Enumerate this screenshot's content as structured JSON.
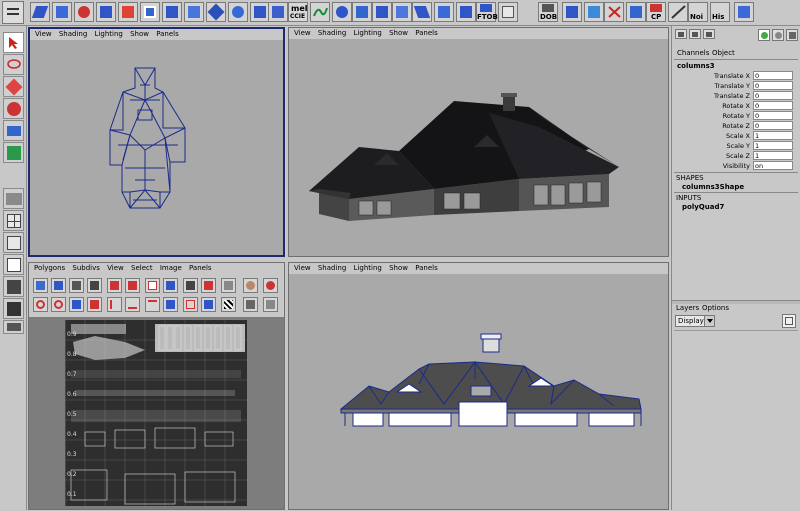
{
  "shelf": {
    "labels": {
      "mel": "mel",
      "ccie": "CCIE",
      "ftob": "FTOB",
      "dob": "DOB",
      "cp": "CP",
      "noi": "Noi",
      "his": "His"
    }
  },
  "panels": {
    "top_left": {
      "menu": [
        "View",
        "Shading",
        "Lighting",
        "Show",
        "Panels"
      ]
    },
    "top_right": {
      "menu": [
        "View",
        "Shading",
        "Lighting",
        "Show",
        "Panels"
      ]
    },
    "uv_editor": {
      "menu": [
        "Polygons",
        "Subdivs",
        "View",
        "Select",
        "Image",
        "Panels"
      ],
      "axis_labels": [
        "0.9",
        "0.8",
        "0.7",
        "0.6",
        "0.5",
        "0.4",
        "0.3",
        "0.2",
        "0.1"
      ]
    },
    "bottom_right": {
      "menu": [
        "View",
        "Shading",
        "Lighting",
        "Show",
        "Panels"
      ]
    }
  },
  "channel_box": {
    "tabs": [
      "Channels",
      "Object"
    ],
    "object_name": "columns3",
    "channels": [
      {
        "label": "Translate X",
        "value": "0"
      },
      {
        "label": "Translate Y",
        "value": "0"
      },
      {
        "label": "Translate Z",
        "value": "0"
      },
      {
        "label": "Rotate X",
        "value": "0"
      },
      {
        "label": "Rotate Y",
        "value": "0"
      },
      {
        "label": "Rotate Z",
        "value": "0"
      },
      {
        "label": "Scale X",
        "value": "1"
      },
      {
        "label": "Scale Y",
        "value": "1"
      },
      {
        "label": "Scale Z",
        "value": "1"
      },
      {
        "label": "Visibility",
        "value": "on"
      }
    ],
    "shapes_header": "SHAPES",
    "shape_name": "columns3Shape",
    "inputs_header": "INPUTS",
    "input_name": "polyQuad7"
  },
  "layers": {
    "menu": [
      "Layers",
      "Options"
    ],
    "display_value": "Display"
  },
  "colors": {
    "ui_gray": "#c8c8c8",
    "viewport_gray": "#a9a9a9",
    "active_border": "#1d2a6e",
    "wireframe_blue": "#1a2a8c"
  }
}
